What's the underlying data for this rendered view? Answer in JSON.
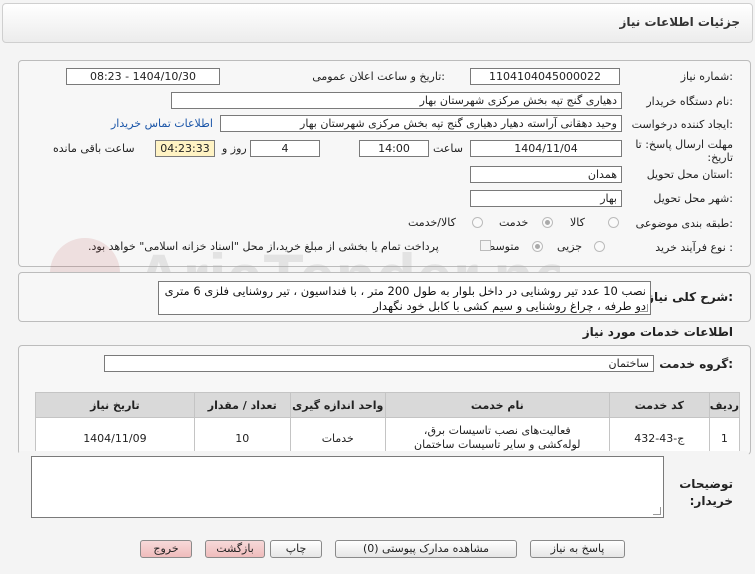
{
  "header": {
    "title": "جزئیات اطلاعات نیاز"
  },
  "form": {
    "need_number_label": "شماره نیاز:",
    "need_number": "1104104045000022",
    "announce_label": "تاریخ و ساعت اعلان عمومی:",
    "announce_value": "1404/10/30 - 08:23",
    "buyer_org_label": "نام دستگاه خریدار:",
    "buyer_org": "دهیاری گنج تپه بخش مرکزی شهرستان بهار",
    "creator_label": "ایجاد کننده درخواست:",
    "creator": "وحید دهقانی آراسته دهیار دهیاری گنج تپه بخش مرکزی شهرستان بهار",
    "contact_link": "اطلاعات تماس خریدار",
    "deadline_label": "مهلت ارسال پاسخ: تا تاریخ:",
    "deadline_date": "1404/11/04",
    "time_label": "ساعت",
    "deadline_time": "14:00",
    "days": "4",
    "days_label": "روز و",
    "remaining_time": "04:23:33",
    "remaining_label": "ساعت باقی مانده",
    "province_label": "استان محل تحویل:",
    "province": "همدان",
    "city_label": "شهر محل تحویل:",
    "city": "بهار",
    "category_label": "طبقه بندی موضوعی:",
    "category_options": [
      "کالا",
      "خدمت",
      "کالا/خدمت"
    ],
    "category_selected": "خدمت",
    "process_label": "نوع فرآیند خرید :",
    "process_options": [
      "جزیی",
      "متوسط"
    ],
    "process_selected": "متوسط",
    "payment_note": "پرداخت تمام یا بخشی از مبلغ خرید،از محل \"اسناد خزانه اسلامی\" خواهد بود."
  },
  "description": {
    "label": "شرح کلی نیاز:",
    "text": "نصب 10 عدد تیر روشنایی در داخل بلوار به طول 200 متر ،  با فنداسیون  ، تیر روشنایی فلزی 6 متری دو طرفه ، چراغ روشنایی  و سیم کشی با کابل خود نگهدار"
  },
  "services": {
    "section_title": "اطلاعات خدمات مورد نیاز",
    "group_label": "گروه خدمت:",
    "group_value": "ساختمان",
    "columns": [
      "ردیف",
      "کد خدمت",
      "نام خدمت",
      "واحد اندازه گیری",
      "تعداد / مقدار",
      "تاریخ نیاز"
    ],
    "rows": [
      {
        "row": "1",
        "code": "ج-43-432",
        "name": "فعالیت‌های نصب تاسیسات برق، لوله‌کشی و سایر تاسیسات ساختمان",
        "unit": "خدمات",
        "qty": "10",
        "date": "1404/11/09"
      }
    ]
  },
  "notes": {
    "label": "توضیحات خریدار:",
    "value": ""
  },
  "buttons": {
    "reply": "پاسخ به نیاز",
    "view_docs": "مشاهده مدارک پیوستی (0)",
    "print": "چاپ",
    "back": "بازگشت",
    "exit": "خروج"
  },
  "watermark": {
    "text": "AriaTender.net"
  },
  "colors": {
    "link": "#1a55a8",
    "exit_button": "#efbcbc",
    "remaining_bg": "#fff3c4"
  }
}
